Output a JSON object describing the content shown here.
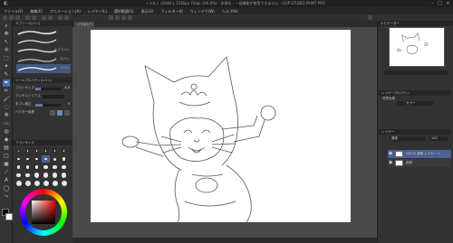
{
  "window": {
    "title": "イラスト (2048 x 1536px 72dpi 100.0%) - 未保存 - 一部機能が使用できません - CLIP STUDIO PAINT PRO"
  },
  "menu": [
    "ファイル(F)",
    "編集(E)",
    "アニメーション(A)",
    "レイヤー(L)",
    "選択範囲(S)",
    "表示(V)",
    "フィルター(I)",
    "ウィンドウ(W)",
    "ヘルプ(H)"
  ],
  "subtool": {
    "header": "サブツール[ペン]",
    "brushes": [
      {
        "label": ""
      },
      {
        "label": ""
      },
      {
        "label": "カブラペン"
      },
      {
        "label": "丸ペン"
      },
      {
        "label": "Gペン"
      }
    ]
  },
  "tool_property": {
    "header": "ツールプロパティ[Gペン]",
    "rows": [
      {
        "label": "ブラシサイズ",
        "value": "4.0"
      },
      {
        "label": "アンチエイリアス",
        "value": ""
      },
      {
        "label": "手ブレ補正",
        "value": "5"
      },
      {
        "label": "ベクター吸着",
        "value": ""
      }
    ],
    "brush_size_fill": 0.2
  },
  "brush_size_panel": {
    "header": "ブラシサイズ"
  },
  "canvas": {
    "tab_label": "イラスト*"
  },
  "navigator": {
    "header": "ナビゲーター"
  },
  "layer_property": {
    "header": "レイヤープロパティ",
    "effect_label": "境界効果",
    "color_label": "カラー"
  },
  "layers": {
    "header": "レイヤー",
    "blend_mode": "通常",
    "opacity": "100",
    "items": [
      {
        "name": "100 % 通常\nレイヤー 1",
        "selected": true
      },
      {
        "name": "用紙",
        "selected": false
      }
    ]
  },
  "colors": {
    "foreground": "#000000",
    "background": "#ffffff",
    "accent": "#4a6192"
  }
}
